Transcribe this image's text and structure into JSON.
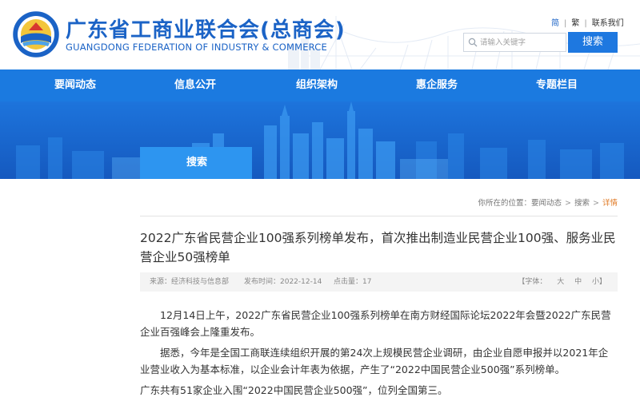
{
  "header": {
    "title": "广东省工商业联合会(总商会)",
    "subtitle": "GUANGDONG FEDERATION OF INDUSTRY & COMMERCE",
    "emblem": "gdfic-emblem",
    "brand_color": "#1b63c6"
  },
  "lang": {
    "simplified": "简",
    "traditional": "繁",
    "contact": "联系我们",
    "separator": "|"
  },
  "search": {
    "placeholder": "请输入关键字",
    "button_label": "搜索",
    "icon": "search-icon"
  },
  "nav": {
    "color": "#1b7ae0",
    "items": [
      {
        "label": "要闻动态"
      },
      {
        "label": "信息公开"
      },
      {
        "label": "组织架构"
      },
      {
        "label": "惠企服务"
      },
      {
        "label": "专题栏目"
      }
    ]
  },
  "banner": {
    "tab_label": "搜索"
  },
  "breadcrumb": {
    "prefix": "你所在的位置：",
    "items": [
      "要闻动态",
      "搜索",
      "详情"
    ],
    "separator": ">"
  },
  "article": {
    "title": "2022广东省民营企业100强系列榜单发布，首次推出制造业民营企业100强、服务业民营企业50强榜单",
    "meta": {
      "source": "来源：经济科技与信息部",
      "date": "发布时间：2022-12-14",
      "views": "点击量：17",
      "font_label": "【字体：",
      "font_large": "大",
      "font_medium": "中",
      "font_small": "小】"
    },
    "paragraphs": [
      "12月14日上午，2022广东省民营企业100强系列榜单在南方财经国际论坛2022年会暨2022广东民营企业百强峰会上隆重发布。",
      "据悉，今年是全国工商联连续组织开展的第24次上规模民营企业调研，由企业自愿申报并以2021年企业营业收入为基本标准，以企业会计年表为依据，产生了“2022中国民营企业500强”系列榜单。",
      "广东共有51家企业入围“2022中国民营企业500强”，位列全国第三。"
    ]
  }
}
